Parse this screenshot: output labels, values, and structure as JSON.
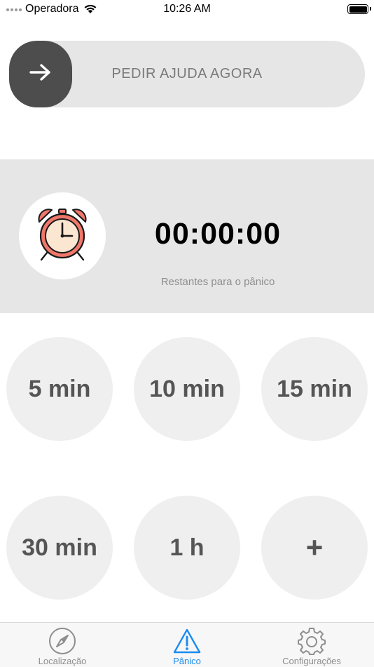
{
  "status_bar": {
    "carrier": "Operadora",
    "time": "10:26 AM"
  },
  "slider": {
    "label": "PEDIR AJUDA AGORA",
    "thumb_icon": "arrow-right-icon"
  },
  "timer": {
    "icon": "alarm-clock-icon",
    "value": "00:00:00",
    "caption": "Restantes para o pânico"
  },
  "time_options": [
    {
      "label": "5 min"
    },
    {
      "label": "10 min"
    },
    {
      "label": "15 min"
    },
    {
      "label": "30 min"
    },
    {
      "label": "1 h"
    },
    {
      "label": "+"
    }
  ],
  "tab_bar": {
    "active": "Pânico",
    "accent_color": "#1a8cf0",
    "tabs": [
      {
        "label": "Localização",
        "icon": "compass-icon"
      },
      {
        "label": "Pânico",
        "icon": "warning-icon"
      },
      {
        "label": "Configurações",
        "icon": "gear-icon"
      }
    ]
  }
}
